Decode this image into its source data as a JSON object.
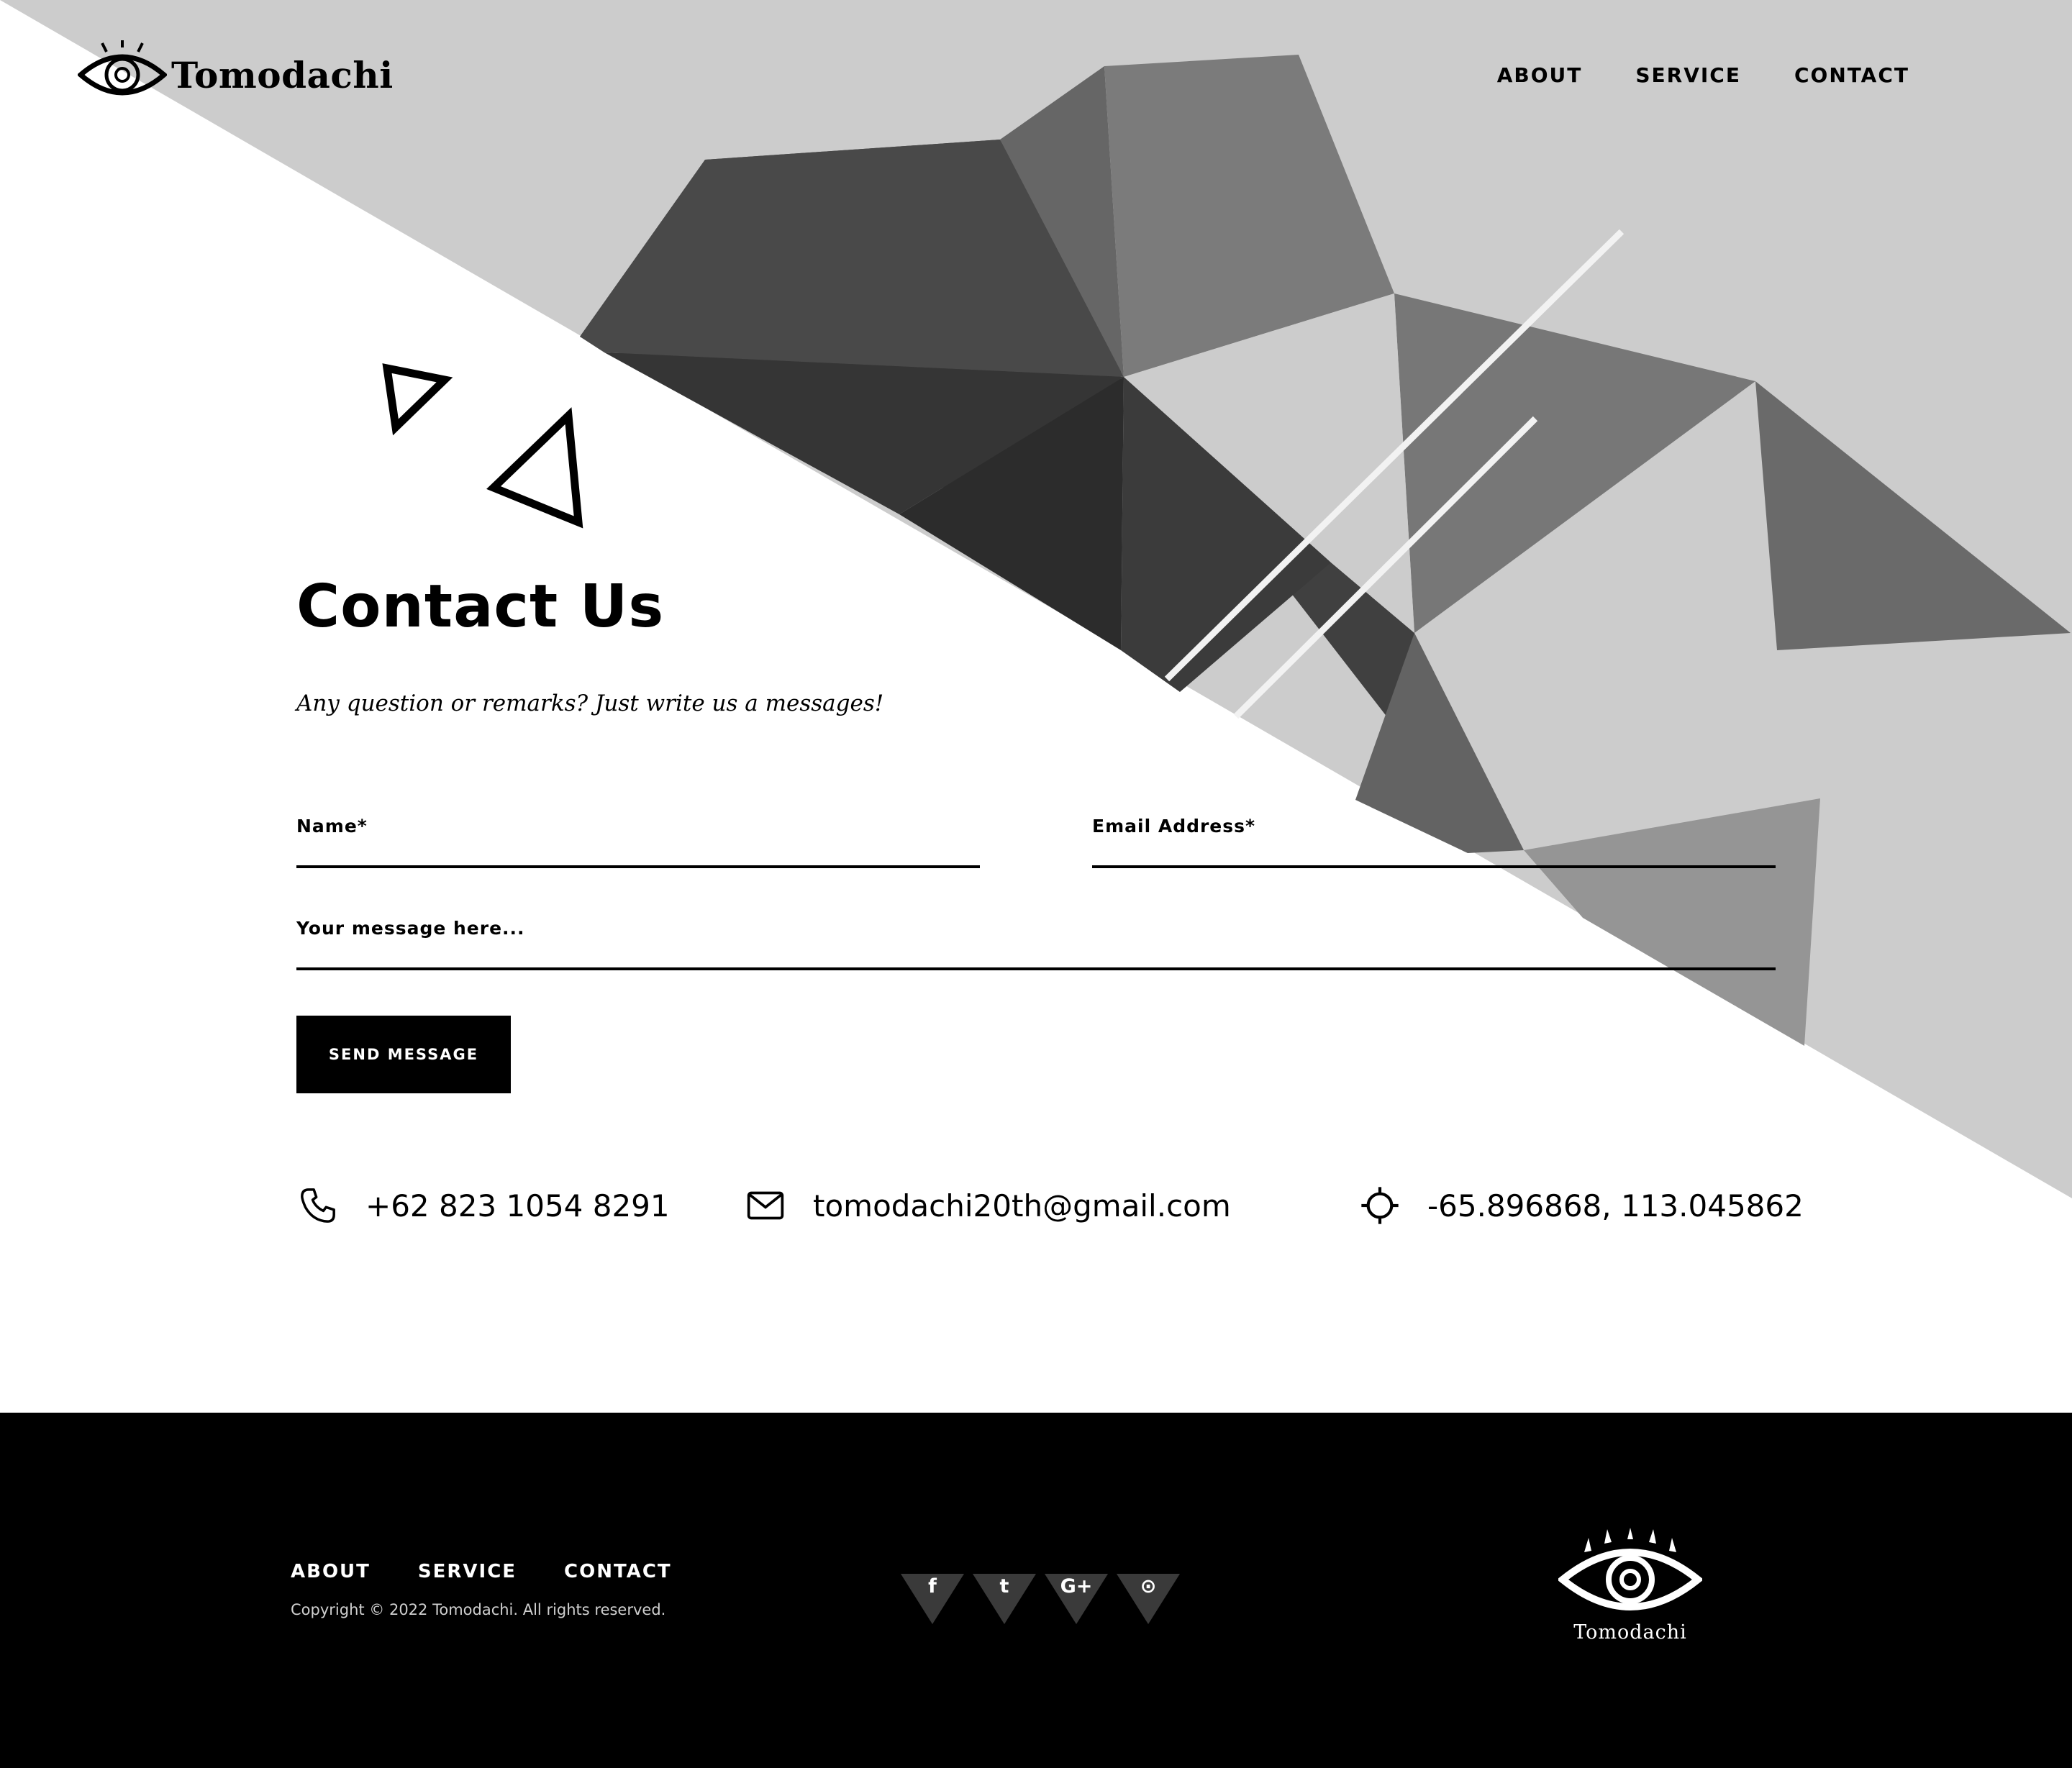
{
  "brand": {
    "name": "Tomodachi",
    "logo_icon": "eye-icon"
  },
  "nav": {
    "items": [
      "ABOUT",
      "SERVICE",
      "CONTACT"
    ]
  },
  "contact": {
    "title": "Contact Us",
    "subtitle": "Any question or remarks? Just write us a messages!",
    "form": {
      "name_label": "Name*",
      "email_label": "Email Address*",
      "message_label": "Your message here...",
      "name_value": "",
      "email_value": "",
      "message_value": "",
      "submit_label": "SEND MESSAGE"
    },
    "info": [
      {
        "icon": "phone-icon",
        "text": "+62 823 1054 8291"
      },
      {
        "icon": "mail-icon",
        "text": "tomodachi20th@gmail.com"
      },
      {
        "icon": "location-icon",
        "text": "-65.896868, 113.045862"
      }
    ]
  },
  "footer": {
    "nav": [
      "ABOUT",
      "SERVICE",
      "CONTACT"
    ],
    "copyright": "Copyright © 2022 Tomodachi. All rights reserved.",
    "social": [
      {
        "icon": "facebook-icon",
        "glyph": "f"
      },
      {
        "icon": "twitter-icon",
        "glyph": "t"
      },
      {
        "icon": "google-plus-icon",
        "glyph": "G+"
      },
      {
        "icon": "github-icon",
        "glyph": "⊙"
      }
    ],
    "logo_text": "Tomodachi"
  },
  "colors": {
    "background": "#ffffff",
    "diagonal_gray": "#cccccc",
    "footer": "#000000",
    "text": "#000000",
    "button": "#000000"
  }
}
